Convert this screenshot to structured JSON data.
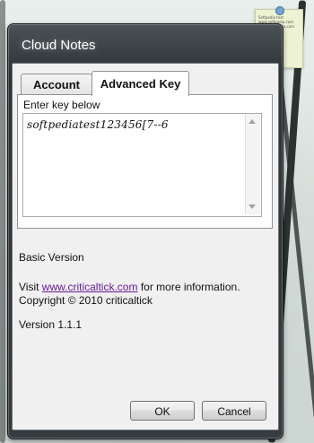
{
  "window": {
    "title": "Cloud Notes"
  },
  "note": {
    "lines": [
      "Softpedia test",
      "www.softpedia.com",
      "test@softpedia.com"
    ]
  },
  "tabs": [
    {
      "label": "Account",
      "active": false
    },
    {
      "label": "Advanced Key",
      "active": true
    }
  ],
  "advanced_key": {
    "label": "Enter key below",
    "value": "softpediatest123456[7--6"
  },
  "about": {
    "edition": "Basic Version",
    "visit_prefix": "Visit ",
    "link_text": "www.criticaltick.com",
    "visit_suffix": " for more information.",
    "copyright": "Copyright © 2010 criticaltick",
    "version": "Version 1.1.1"
  },
  "buttons": {
    "ok": "OK",
    "cancel": "Cancel"
  }
}
